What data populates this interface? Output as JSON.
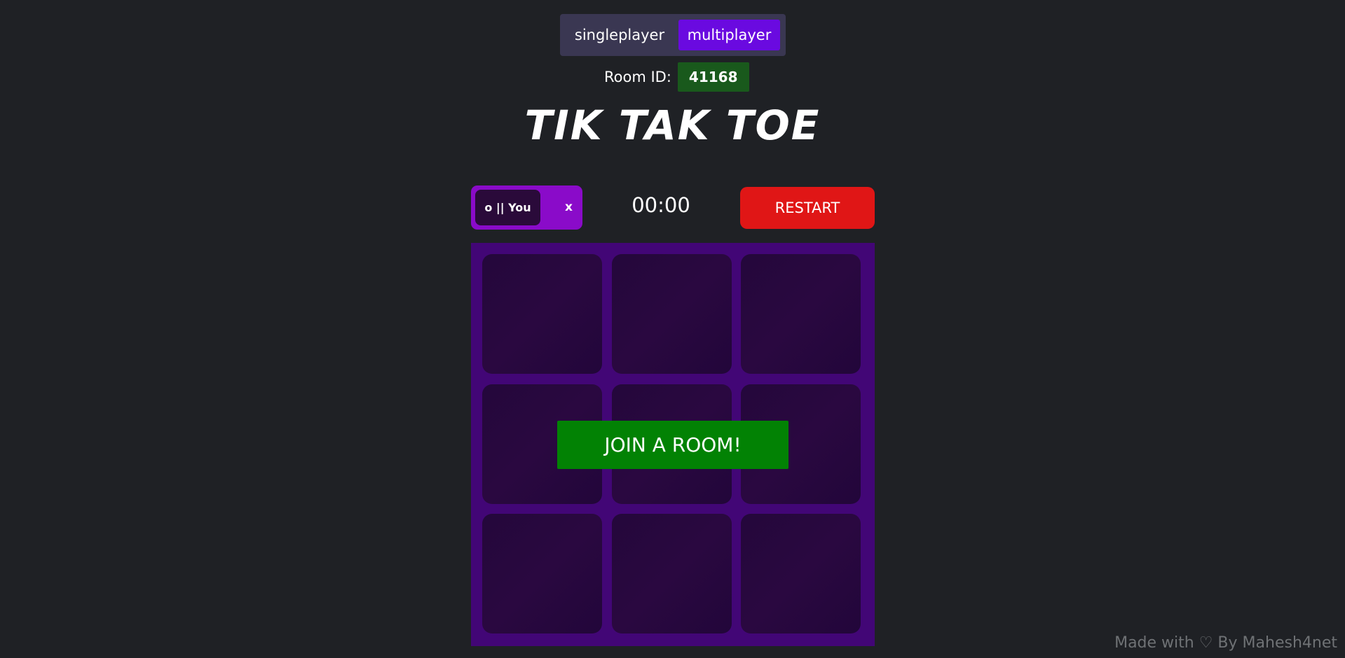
{
  "mode_toggle": {
    "singleplayer_label": "singleplayer",
    "multiplayer_label": "multiplayer",
    "active": "multiplayer"
  },
  "room": {
    "label": "Room ID:",
    "id": "41168"
  },
  "title": "TIK TAK TOE",
  "player_toggle": {
    "o_label": "o || You",
    "x_label": "x"
  },
  "timer": "00:00",
  "restart_label": "RESTART",
  "board": {
    "cells": [
      "",
      "",
      "",
      "",
      "",
      "",
      "",
      "",
      ""
    ]
  },
  "join_label": "JOIN A ROOM!",
  "footer": "Made with ♡ By Mahesh4net",
  "colors": {
    "background": "#1f2125",
    "accent_purple": "#6a0ae0",
    "board": "#420676",
    "restart": "#e01616",
    "join": "#028204",
    "room_id_bg": "#19591c"
  }
}
